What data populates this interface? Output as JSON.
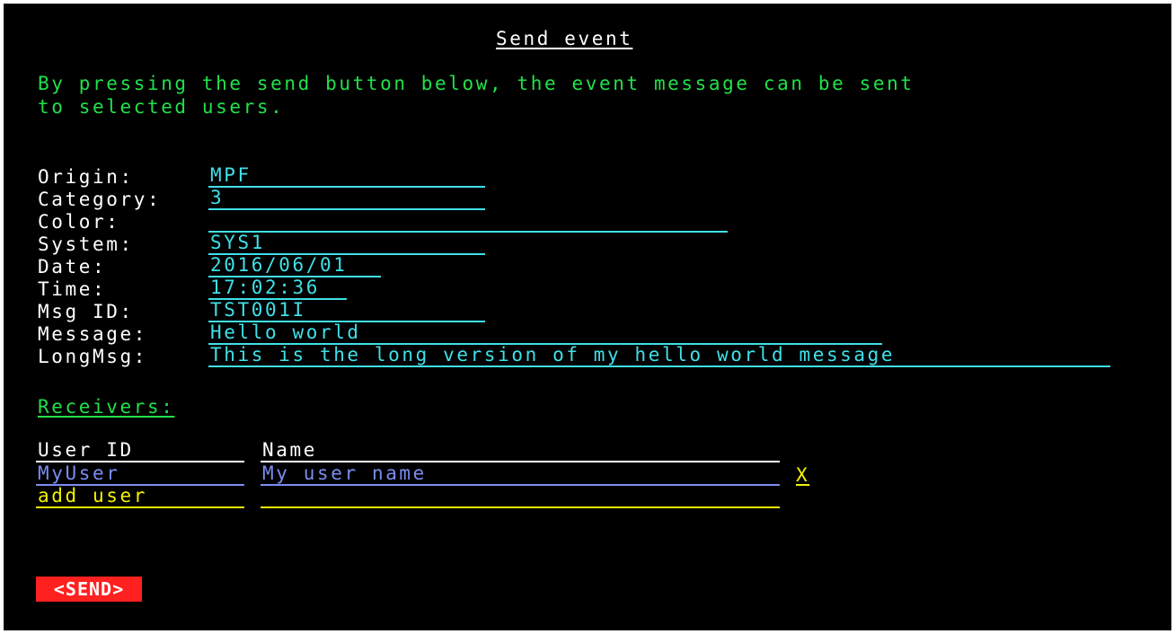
{
  "title": "Send event",
  "intro_lines": [
    "By pressing the send button below, the event message can be sent",
    "to selected users."
  ],
  "fields": [
    {
      "label": "Origin:",
      "value": "MPF"
    },
    {
      "label": "Category:",
      "value": "3"
    },
    {
      "label": "Color:",
      "value": ""
    },
    {
      "label": "System:",
      "value": "SYS1"
    },
    {
      "label": "Date:",
      "value": "2016/06/01"
    },
    {
      "label": "Time:",
      "value": "17:02:36"
    },
    {
      "label": "Msg ID:",
      "value": "TST001I"
    },
    {
      "label": "Message:",
      "value": "Hello world"
    },
    {
      "label": "LongMsg:",
      "value": "This is the long version of my hello world message"
    }
  ],
  "receivers": {
    "heading": "Receivers:",
    "columns": {
      "user_id": "User ID",
      "name": "Name"
    },
    "rows": [
      {
        "user_id": "MyUser",
        "name": "My user name",
        "delete": "X"
      }
    ],
    "add_row": {
      "user_id": "add user",
      "name": ""
    }
  },
  "send_label": "<SEND>",
  "colors": {
    "background": "#000000",
    "label": "#ffffff",
    "intro": "#22e04a",
    "field_value": "#40e0e8",
    "receiver_row": "#7b8cf0",
    "add_row": "#f2f200",
    "send_button": "#ff2020"
  }
}
